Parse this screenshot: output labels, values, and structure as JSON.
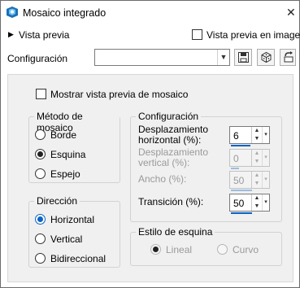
{
  "window": {
    "title": "Mosaico integrado",
    "app_icon": "psp-app-icon",
    "close_glyph": "✕"
  },
  "preview": {
    "expander_glyph": "▶",
    "label": "Vista previa",
    "checkbox_label": "Vista previa en imagen",
    "checked": false
  },
  "presets": {
    "label": "Configuración",
    "value": "",
    "buttons": [
      "save-preset-icon",
      "randomize-icon",
      "reset-icon"
    ]
  },
  "options": {
    "show_mosaic_preview_label": "Mostrar vista previa de mosaico",
    "show_mosaic_preview_checked": false,
    "method": {
      "title": "Método de mosaico",
      "items": [
        {
          "label": "Borde",
          "checked": false
        },
        {
          "label": "Esquina",
          "checked": true
        },
        {
          "label": "Espejo",
          "checked": false
        }
      ]
    },
    "direction": {
      "title": "Dirección",
      "items": [
        {
          "label": "Horizontal",
          "checked": true
        },
        {
          "label": "Vertical",
          "checked": false
        },
        {
          "label": "Bidireccional",
          "checked": false
        }
      ]
    },
    "settings": {
      "title": "Configuración",
      "horizontal_offset": {
        "label_line1": "Desplazamiento",
        "label_line2": "horizontal (%):",
        "value": "6",
        "enabled": true,
        "slider_fraction": 0.06
      },
      "vertical_offset": {
        "label_line1": "Desplazamiento",
        "label_line2": "vertical (%):",
        "value": "0",
        "enabled": false,
        "slider_fraction": 0.0
      },
      "width": {
        "label": "Ancho (%):",
        "value": "50",
        "enabled": false,
        "slider_fraction": 0.5
      },
      "transition": {
        "label": "Transición (%):",
        "value": "50",
        "enabled": true,
        "slider_fraction": 0.5
      }
    },
    "corner_style": {
      "title": "Estilo de esquina",
      "items": [
        {
          "label": "Lineal",
          "checked": true,
          "enabled": false
        },
        {
          "label": "Curvo",
          "checked": false,
          "enabled": false
        }
      ]
    }
  },
  "colors": {
    "accent": "#0b63c4",
    "panel_bg": "#f0f0f0",
    "disabled_text": "#9a9a9a"
  }
}
